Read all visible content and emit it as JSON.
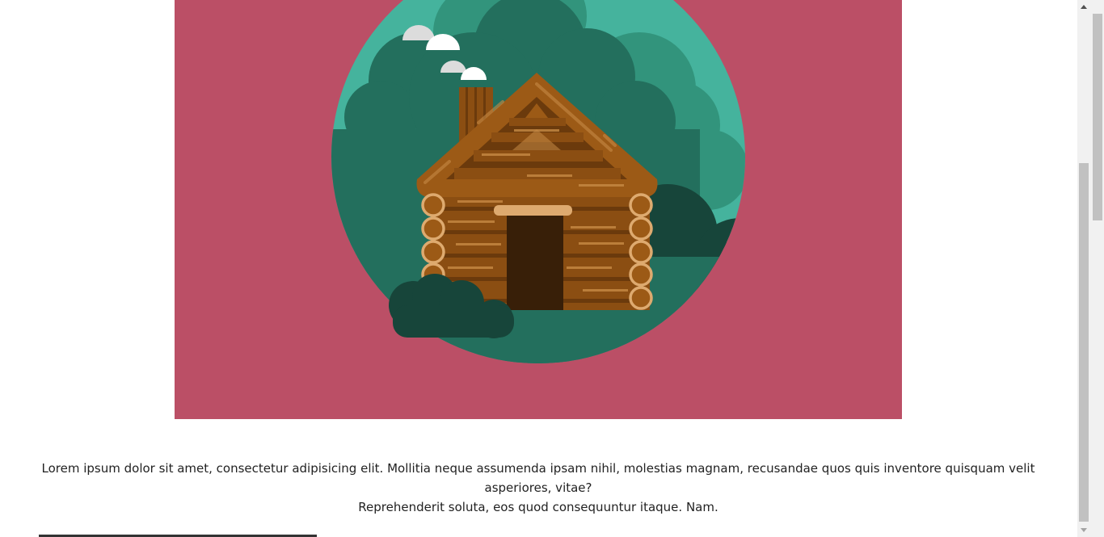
{
  "hero": {
    "illustration": "log-cabin-in-forest",
    "background_color": "#bb4f66",
    "circle_color": "#45b39d"
  },
  "caption": {
    "line1": "Lorem ipsum dolor sit amet, consectetur adipisicing elit. Mollitia neque assumenda ipsam nihil, molestias magnam, recusandae quos quis inventore quisquam velit asperiores, vitae?",
    "line2": "Reprehenderit soluta, eos quod consequuntur itaque. Nam."
  },
  "scrollbar": {
    "up_icon": "arrow-up-icon",
    "down_icon": "arrow-down-icon"
  }
}
